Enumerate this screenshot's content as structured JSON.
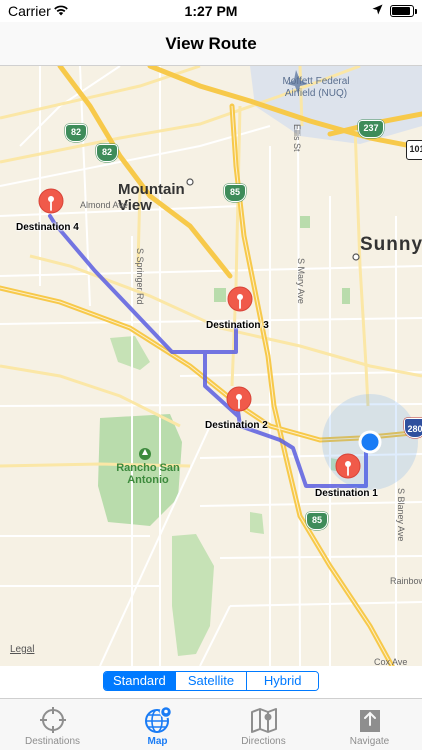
{
  "status_bar": {
    "carrier": "Carrier",
    "time": "1:27 PM",
    "battery_level": 0.9
  },
  "nav": {
    "title": "View Route"
  },
  "map": {
    "cities": {
      "mountain_view": "Mountain\nView",
      "sunnyvale": "Sunnyv"
    },
    "pois": {
      "airfield": "Moffett Federal\nAirfield (NUQ)",
      "park": "Rancho San\nAntonio"
    },
    "streets": {
      "almond": "Almond Ave",
      "springer": "S Springer Rd",
      "mary": "S Mary Ave",
      "ellis": "Ellis St",
      "blaney": "S Blaney Ave",
      "rainbow": "Rainbow",
      "cox": "Cox Ave"
    },
    "shields": {
      "sr82_a": "82",
      "sr82_b": "82",
      "sr85_a": "85",
      "sr85_b": "85",
      "sr237": "237",
      "i280": "280",
      "us101": "101"
    },
    "destinations": [
      "Destination 1",
      "Destination 2",
      "Destination 3",
      "Destination 4"
    ],
    "legal": "Legal",
    "colors": {
      "route": "#5a5ee0",
      "pin": "#f05a4a",
      "user_location": "#1a7cf5",
      "highway": "#f7c94a",
      "park": "#b9dcac",
      "water": "#8fc3e8"
    }
  },
  "segmented": {
    "options": [
      "Standard",
      "Satellite",
      "Hybrid"
    ],
    "selected": "Standard"
  },
  "tabs": [
    {
      "label": "Destinations",
      "icon": "crosshair-icon",
      "active": false
    },
    {
      "label": "Map",
      "icon": "globe-icon",
      "active": true
    },
    {
      "label": "Directions",
      "icon": "folded-map-icon",
      "active": false
    },
    {
      "label": "Navigate",
      "icon": "share-arrow-icon",
      "active": false
    }
  ]
}
